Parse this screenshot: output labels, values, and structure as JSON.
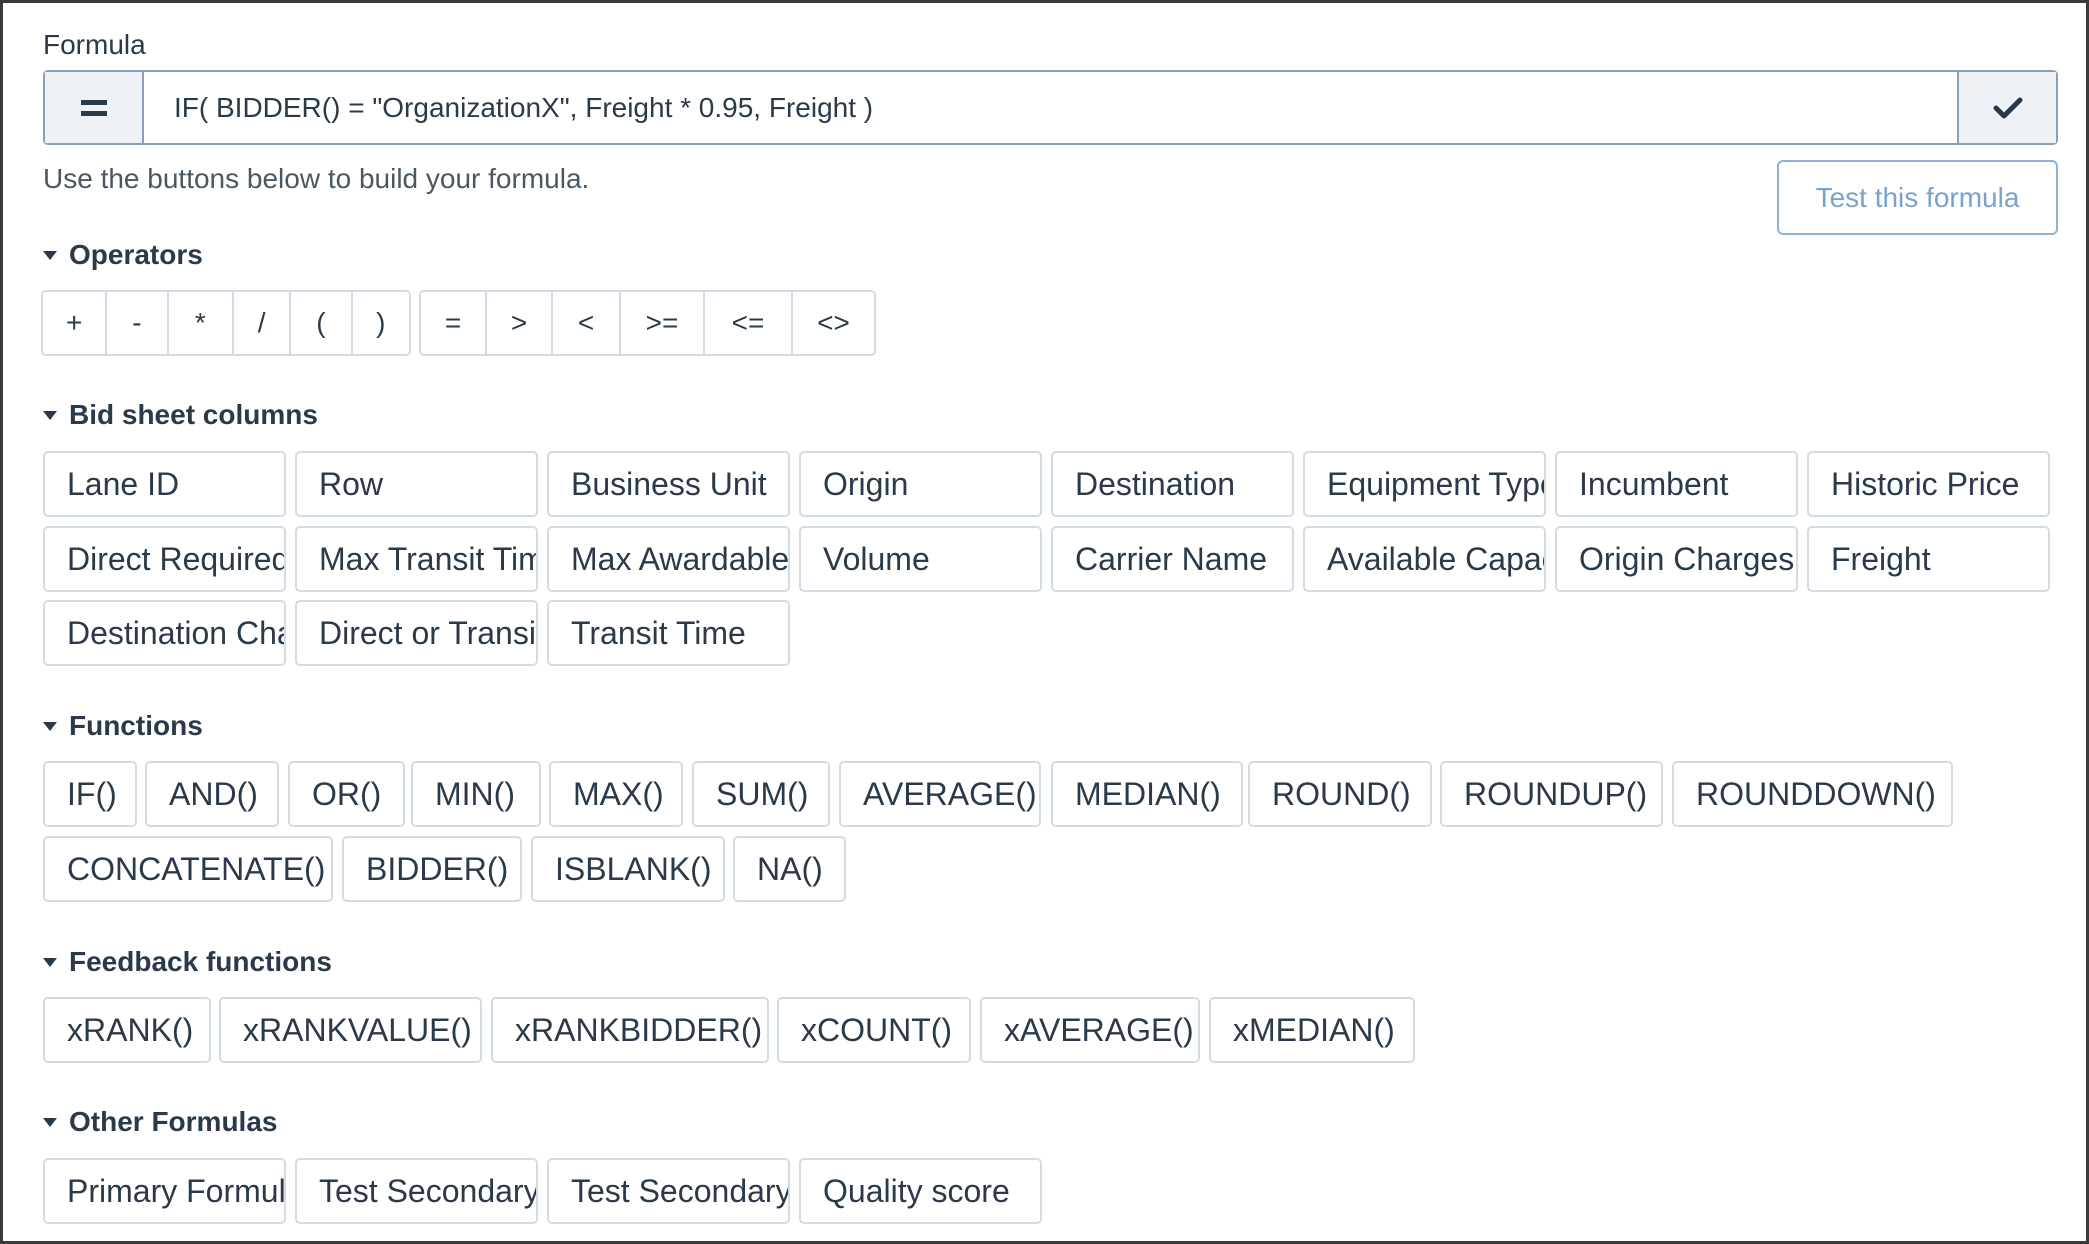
{
  "formula": {
    "label": "Formula",
    "value": "IF( BIDDER() = \"OrganizationX\", Freight * 0.95, Freight )",
    "hint": "Use the buttons below to build your formula.",
    "test_label": "Test this formula"
  },
  "sections": {
    "operators": "Operators",
    "columns": "Bid sheet columns",
    "functions": "Functions",
    "feedback": "Feedback functions",
    "other": "Other Formulas"
  },
  "operators": {
    "arith": [
      "+",
      "-",
      "*",
      "/",
      "(",
      ")"
    ],
    "compare": [
      "=",
      ">",
      "<",
      ">=",
      "<=",
      "<>"
    ]
  },
  "columns": [
    "Lane ID",
    "Row",
    "Business Unit",
    "Origin",
    "Destination",
    "Equipment Type",
    "Incumbent",
    "Historic Price",
    "Direct Required",
    "Max Transit Time",
    "Max Awardable",
    "Volume",
    "Carrier Name",
    "Available Capacity",
    "Origin Charges",
    "Freight",
    "Destination Charges",
    "Direct or Transit",
    "Transit Time"
  ],
  "functions": [
    "IF()",
    "AND()",
    "OR()",
    "MIN()",
    "MAX()",
    "SUM()",
    "AVERAGE()",
    "MEDIAN()",
    "ROUND()",
    "ROUNDUP()",
    "ROUNDDOWN()",
    "CONCATENATE()",
    "BIDDER()",
    "ISBLANK()",
    "NA()"
  ],
  "feedback_functions": [
    "xRANK()",
    "xRANKVALUE()",
    "xRANKBIDDER()",
    "xCOUNT()",
    "xAVERAGE()",
    "xMEDIAN()"
  ],
  "other_formulas": [
    "Primary Formula",
    "Test Secondary",
    "Test Secondary",
    "Quality score"
  ],
  "icons": {
    "equals": "equals-icon",
    "check": "check-icon",
    "caret": "caret-down-icon"
  },
  "colors": {
    "text": "#2b3a4a",
    "border": "#d3dce5",
    "input_border": "#8c9fb4",
    "accent_button": "#7aa3cc"
  }
}
